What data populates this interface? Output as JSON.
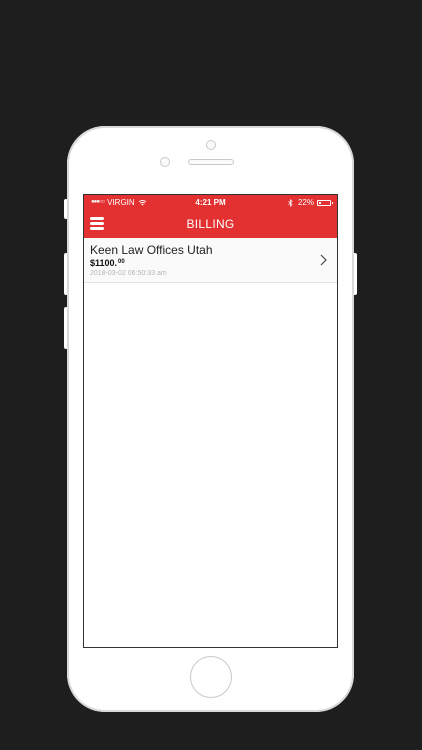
{
  "status_bar": {
    "signal": "●●●○○",
    "carrier": "VIRGIN",
    "time": "4:21 PM",
    "battery": "22%",
    "battery_level": 0.22
  },
  "nav": {
    "title": "BILLING",
    "menu_icon": "menu-icon"
  },
  "billing_items": [
    {
      "title": "Keen Law Offices Utah",
      "amount_main": "$1100.",
      "amount_cents": "00",
      "date": "2018-03-02 06:50:33 am"
    }
  ],
  "colors": {
    "accent": "#e33131",
    "background": "#1e1e1e"
  }
}
